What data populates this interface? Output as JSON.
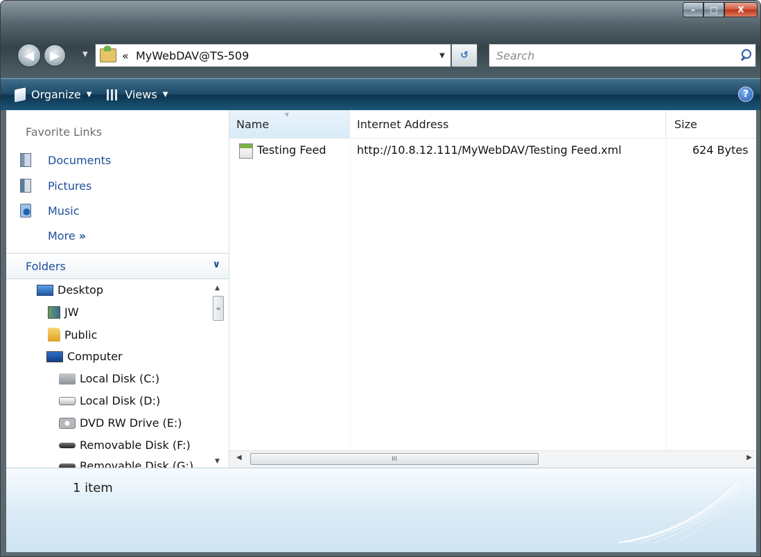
{
  "window": {
    "caption": {
      "minimize": "–",
      "maximize": "□",
      "close": "X"
    }
  },
  "nav": {
    "back_glyph": "◀",
    "forward_glyph": "▶",
    "address": {
      "prefix": "«",
      "path": "MyWebDAV@TS-509"
    },
    "refresh_glyph": "↺",
    "search_placeholder": "Search"
  },
  "toolbar": {
    "organize_label": "Organize",
    "views_label": "Views",
    "help_glyph": "?"
  },
  "sidebar": {
    "favorites_title": "Favorite Links",
    "favorites": [
      {
        "label": "Documents",
        "icon": "documents-icon"
      },
      {
        "label": "Pictures",
        "icon": "pictures-icon"
      },
      {
        "label": "Music",
        "icon": "music-icon"
      }
    ],
    "more_label": "More",
    "more_glyph": "»",
    "folders_label": "Folders",
    "tree": [
      {
        "label": "Desktop",
        "icon": "desktop-icon"
      },
      {
        "label": "JW",
        "icon": "user-folder-icon"
      },
      {
        "label": "Public",
        "icon": "folder-icon"
      },
      {
        "label": "Computer",
        "icon": "computer-icon"
      },
      {
        "label": "Local Disk (C:)",
        "icon": "system-disk-icon"
      },
      {
        "label": "Local Disk (D:)",
        "icon": "disk-icon"
      },
      {
        "label": "DVD RW Drive (E:)",
        "icon": "dvd-drive-icon"
      },
      {
        "label": "Removable Disk (F:)",
        "icon": "removable-disk-icon"
      },
      {
        "label": "Removable Disk (G:)",
        "icon": "removable-disk-icon"
      }
    ]
  },
  "content": {
    "columns": {
      "name": "Name",
      "address": "Internet Address",
      "size": "Size"
    },
    "rows": [
      {
        "name": "Testing Feed",
        "address": "http://10.8.12.111/MyWebDAV/Testing Feed.xml",
        "size": "624 Bytes",
        "icon": "xml-feed-icon"
      }
    ],
    "scroll_grip": "III"
  },
  "details": {
    "item_count": "1 item"
  },
  "colors": {
    "toolbar_dark": "#0d3451",
    "link_blue": "#1e4e99",
    "selected_header": "#d8ebf8",
    "details_bg": "#dcecf7"
  }
}
